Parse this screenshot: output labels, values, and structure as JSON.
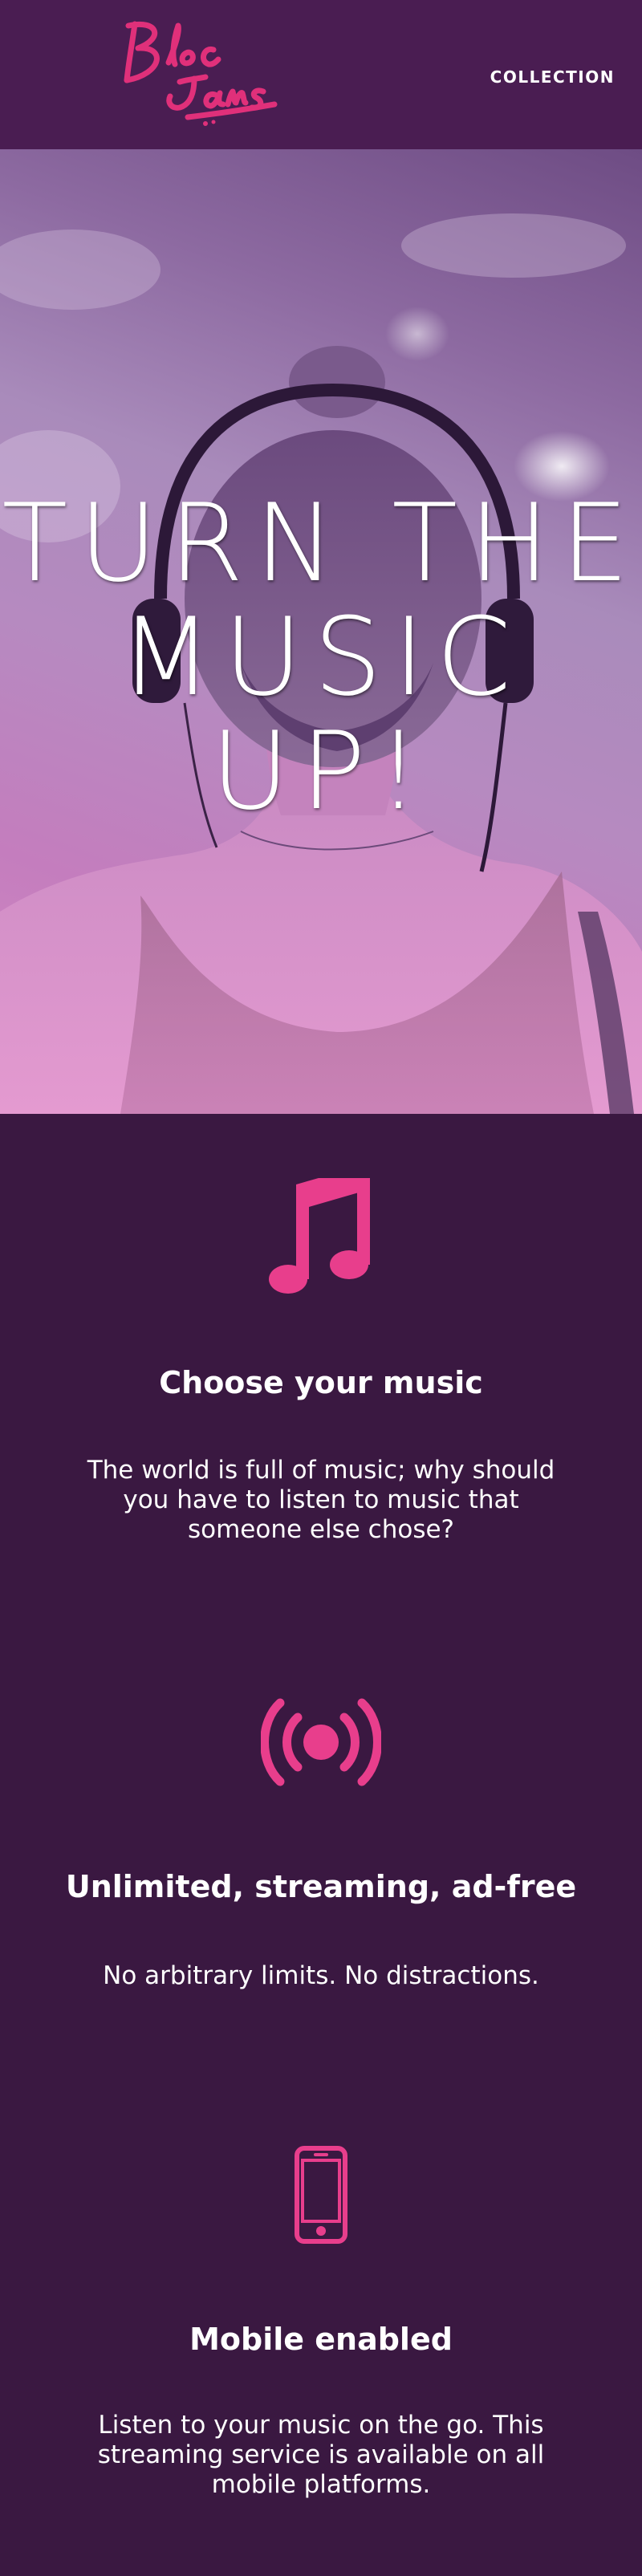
{
  "navbar": {
    "logo_text": "Bloc Jams",
    "collection_link": "COLLECTION"
  },
  "hero": {
    "title_line1": "TURN THE",
    "title_line2": "MUSIC UP!"
  },
  "features": [
    {
      "icon": "music-note-icon",
      "title": "Choose your music",
      "description": "The world is full of music; why should you have to listen to music that someone else chose?"
    },
    {
      "icon": "radio-broadcast-icon",
      "title": "Unlimited, streaming, ad-free",
      "description": "No arbitrary limits. No distractions."
    },
    {
      "icon": "mobile-phone-icon",
      "title": "Mobile enabled",
      "description": "Listen to your music on the go. This streaming service is available on all mobile platforms."
    }
  ],
  "colors": {
    "background": "#3a1841",
    "navbar": "#4a1d52",
    "accent": "#e83e8c",
    "text": "#ffffff"
  }
}
